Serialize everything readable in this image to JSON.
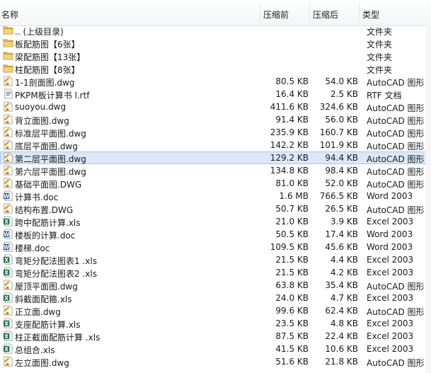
{
  "columns": {
    "name": "名称",
    "packed": "压缩前",
    "compressed": "压缩后",
    "type": "类型"
  },
  "files": [
    {
      "name": ".. (上级目录)",
      "orig": "",
      "comp": "",
      "type": "文件夹",
      "icon": "folder"
    },
    {
      "name": "板配筋图【6张】",
      "orig": "",
      "comp": "",
      "type": "文件夹",
      "icon": "folder"
    },
    {
      "name": "梁配筋图【13张】",
      "orig": "",
      "comp": "",
      "type": "文件夹",
      "icon": "folder"
    },
    {
      "name": "柱配筋图【8张】",
      "orig": "",
      "comp": "",
      "type": "文件夹",
      "icon": "folder"
    },
    {
      "name": "1-1剖面图.dwg",
      "orig": "80.5 KB",
      "comp": "54.0 KB",
      "type": "AutoCAD 图形",
      "icon": "dwg"
    },
    {
      "name": "PKPM板计算书 l.rtf",
      "orig": "16.4 KB",
      "comp": "2.5 KB",
      "type": "RTF 文档",
      "icon": "rtf"
    },
    {
      "name": "suoyou.dwg",
      "orig": "411.6 KB",
      "comp": "324.6 KB",
      "type": "AutoCAD 图形",
      "icon": "dwg"
    },
    {
      "name": "背立面图.dwg",
      "orig": "91.4 KB",
      "comp": "56.0 KB",
      "type": "AutoCAD 图形",
      "icon": "dwg"
    },
    {
      "name": "标准层平面图.dwg",
      "orig": "235.9 KB",
      "comp": "160.7 KB",
      "type": "AutoCAD 图形",
      "icon": "dwg"
    },
    {
      "name": "底层平面图.dwg",
      "orig": "142.2 KB",
      "comp": "101.9 KB",
      "type": "AutoCAD 图形",
      "icon": "dwg"
    },
    {
      "name": "第二层平面图.dwg",
      "orig": "129.2 KB",
      "comp": "94.4 KB",
      "type": "AutoCAD 图形",
      "icon": "dwg",
      "selected": true
    },
    {
      "name": "第六层平面图.dwg",
      "orig": "134.8 KB",
      "comp": "98.4 KB",
      "type": "AutoCAD 图形",
      "icon": "dwg"
    },
    {
      "name": "基础平面图.DWG",
      "orig": "81.0 KB",
      "comp": "52.0 KB",
      "type": "AutoCAD 图形",
      "icon": "dwg"
    },
    {
      "name": "计算书.doc",
      "orig": "1.6 MB",
      "comp": "766.5 KB",
      "type": "Word 2003",
      "icon": "doc"
    },
    {
      "name": "结构布置.DWG",
      "orig": "50.7 KB",
      "comp": "26.5 KB",
      "type": "AutoCAD 图形",
      "icon": "dwg"
    },
    {
      "name": "跨中配筋计算.xls",
      "orig": "21.0 KB",
      "comp": "3.9 KB",
      "type": "Excel 2003",
      "icon": "xls"
    },
    {
      "name": "楼板的计算.doc",
      "orig": "50.5 KB",
      "comp": "17.4 KB",
      "type": "Word 2003",
      "icon": "doc"
    },
    {
      "name": "楼梯.doc",
      "orig": "109.5 KB",
      "comp": "45.6 KB",
      "type": "Word 2003",
      "icon": "doc"
    },
    {
      "name": "弯矩分配法图表1 .xls",
      "orig": "21.5 KB",
      "comp": "4.4 KB",
      "type": "Excel 2003",
      "icon": "xls"
    },
    {
      "name": "弯矩分配法图表2 .xls",
      "orig": "21.5 KB",
      "comp": "4.2 KB",
      "type": "Excel 2003",
      "icon": "xls"
    },
    {
      "name": "屋顶平面图.dwg",
      "orig": "63.8 KB",
      "comp": "35.4 KB",
      "type": "AutoCAD 图形",
      "icon": "dwg"
    },
    {
      "name": "斜截面配箍.xls",
      "orig": "24.0 KB",
      "comp": "4.7 KB",
      "type": "Excel 2003",
      "icon": "xls"
    },
    {
      "name": "正立面.dwg",
      "orig": "99.6 KB",
      "comp": "62.4 KB",
      "type": "AutoCAD 图形",
      "icon": "dwg"
    },
    {
      "name": "支座配筋计算.xls",
      "orig": "23.5 KB",
      "comp": "4.8 KB",
      "type": "Excel 2003",
      "icon": "xls"
    },
    {
      "name": "柱正截面配筋计算 .xls",
      "orig": "87.5 KB",
      "comp": "22.4 KB",
      "type": "Excel 2003",
      "icon": "xls"
    },
    {
      "name": "总组合.xls",
      "orig": "41.5 KB",
      "comp": "10.6 KB",
      "type": "Excel 2003",
      "icon": "xls"
    },
    {
      "name": "左立面图.dwg",
      "orig": "51.6 KB",
      "comp": "21.8 KB",
      "type": "AutoCAD 图形",
      "icon": "dwg"
    }
  ],
  "colors": {
    "selection": "#dbe8f9",
    "folder": "#e8b84a",
    "dwg": "#e3a21a",
    "doc": "#2b5797",
    "xls": "#1e7145"
  }
}
